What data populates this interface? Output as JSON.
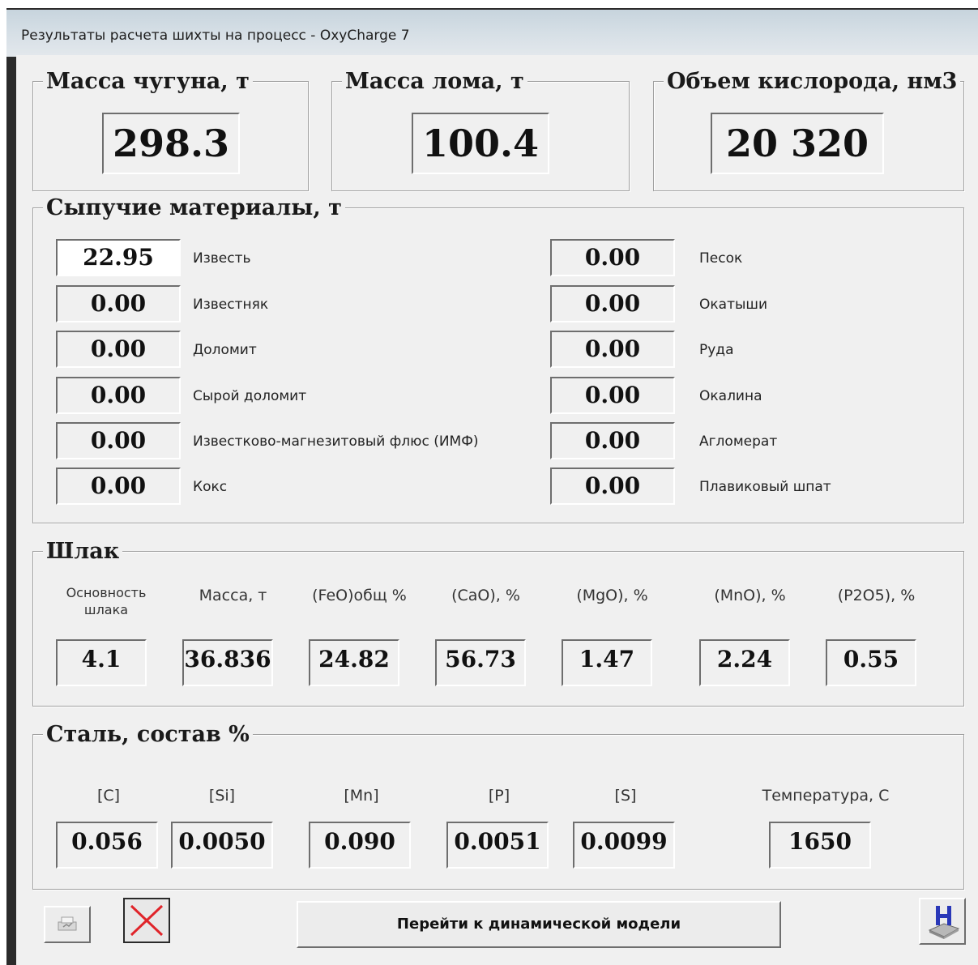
{
  "window": {
    "title": "Результаты расчета шихты на процесс - OxyCharge 7"
  },
  "top": {
    "iron": {
      "legend": "Масса чугуна, т",
      "value": "298.3"
    },
    "scrap": {
      "legend": "Масса лома, т",
      "value": "100.4"
    },
    "oxygen": {
      "legend": "Объем кислорода, нм3",
      "value": "20 320"
    }
  },
  "bulk": {
    "legend": "Сыпучие материалы, т",
    "left": [
      {
        "label": "Известь",
        "value": "22.95"
      },
      {
        "label": "Известняк",
        "value": "0.00"
      },
      {
        "label": "Доломит",
        "value": "0.00"
      },
      {
        "label": "Сырой доломит",
        "value": "0.00"
      },
      {
        "label": "Известково-магнезитовый флюс (ИМФ)",
        "value": "0.00"
      },
      {
        "label": "Кокс",
        "value": "0.00"
      }
    ],
    "right": [
      {
        "label": "Песок",
        "value": "0.00"
      },
      {
        "label": "Окатыши",
        "value": "0.00"
      },
      {
        "label": "Руда",
        "value": "0.00"
      },
      {
        "label": "Окалина",
        "value": "0.00"
      },
      {
        "label": "Агломерат",
        "value": "0.00"
      },
      {
        "label": "Плавиковый шпат",
        "value": "0.00"
      }
    ]
  },
  "slag": {
    "legend": "Шлак",
    "items": [
      {
        "header": "Основность шлака",
        "value": "4.1"
      },
      {
        "header": "Масса, т",
        "value": "36.836"
      },
      {
        "header": "(FeO)общ %",
        "value": "24.82"
      },
      {
        "header": "(CaO), %",
        "value": "56.73"
      },
      {
        "header": "(MgO), %",
        "value": "1.47"
      },
      {
        "header": "(MnO), %",
        "value": "2.24"
      },
      {
        "header": "(P2O5), %",
        "value": "0.55"
      }
    ]
  },
  "steel": {
    "legend": "Сталь, состав %",
    "items": [
      {
        "header": "[C]",
        "value": "0.056"
      },
      {
        "header": "[Si]",
        "value": "0.0050"
      },
      {
        "header": "[Mn]",
        "value": "0.090"
      },
      {
        "header": "[P]",
        "value": "0.0051"
      },
      {
        "header": "[S]",
        "value": "0.0099"
      },
      {
        "header": "Температура, С",
        "value": "1650"
      }
    ]
  },
  "buttons": {
    "dynamic_model": "Перейти к динамической модели"
  },
  "icons": {
    "print": "print-icon",
    "close": "close-x-icon",
    "help": "help-h-icon"
  }
}
